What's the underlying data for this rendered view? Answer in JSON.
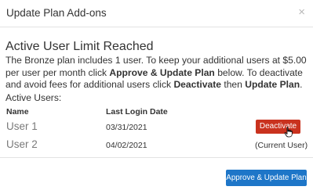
{
  "header": {
    "title": "Update Plan Add-ons",
    "close_symbol": "×"
  },
  "content": {
    "heading": "Active User Limit Reached",
    "desc_part1": "The Bronze plan includes 1 user. To keep your additional users at $5.00 per user per month click ",
    "desc_bold1": "Approve & Update Plan",
    "desc_part2": " below. To deactivate and avoid fees for additional users click ",
    "desc_bold2": "Deactivate",
    "desc_part3": " then ",
    "desc_bold3": "Update Plan",
    "desc_part4": ".",
    "active_users_label": "Active Users:"
  },
  "table": {
    "columns": [
      "Name",
      "Last Login Date"
    ],
    "rows": [
      {
        "name": "User 1",
        "last_login": "03/31/2021",
        "action": "Deactivate"
      },
      {
        "name": "User 2",
        "last_login": "04/02/2021",
        "status": "(Current User)"
      }
    ]
  },
  "footer": {
    "approve_label": "Approve & Update Plan"
  },
  "colors": {
    "deactivate_button": "#c9321e",
    "approve_button": "#1e76c8"
  },
  "icons": [
    "close-icon",
    "hand-pointer-cursor-icon"
  ]
}
